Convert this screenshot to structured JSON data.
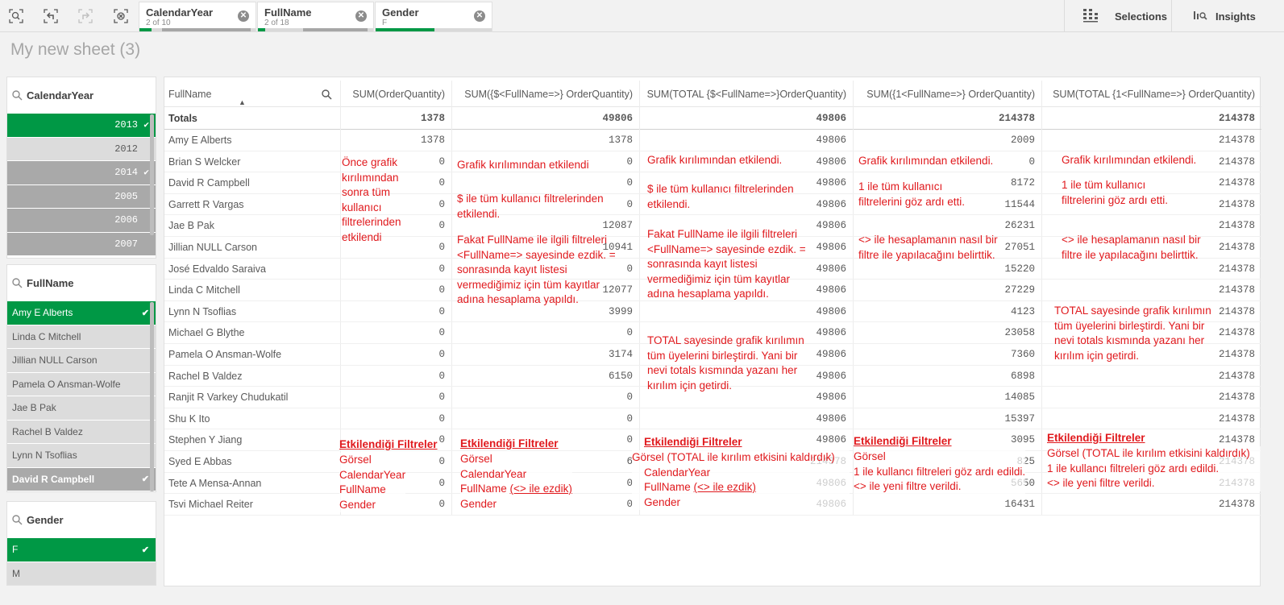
{
  "toolbar": {
    "chips": [
      {
        "title": "CalendarYear",
        "subtitle": "2 of 10",
        "selected_fraction": 0.2
      },
      {
        "title": "FullName",
        "subtitle": "2 of 18",
        "selected_fraction": 0.06
      },
      {
        "title": "Gender",
        "subtitle": "F",
        "selected_fraction": 0.5
      }
    ],
    "selections_label": "Selections",
    "insights_label": "Insights"
  },
  "sheet_title": "My new sheet (3)",
  "listboxes": {
    "calendar_year": {
      "title": "CalendarYear",
      "items": [
        {
          "label": "2013",
          "state": "selected"
        },
        {
          "label": "2012",
          "state": "alternative"
        },
        {
          "label": "2014",
          "state": "excluded-checked"
        },
        {
          "label": "2005",
          "state": "excluded"
        },
        {
          "label": "2006",
          "state": "excluded"
        },
        {
          "label": "2007",
          "state": "excluded"
        }
      ]
    },
    "full_name": {
      "title": "FullName",
      "items": [
        {
          "label": "Amy E Alberts",
          "state": "selected"
        },
        {
          "label": "Linda C Mitchell",
          "state": "alternative"
        },
        {
          "label": "Jillian NULL Carson",
          "state": "alternative"
        },
        {
          "label": "Pamela O Ansman-Wolfe",
          "state": "alternative"
        },
        {
          "label": "Jae B Pak",
          "state": "alternative"
        },
        {
          "label": "Rachel B Valdez",
          "state": "alternative"
        },
        {
          "label": "Lynn N Tsoflias",
          "state": "alternative"
        },
        {
          "label": "David R Campbell",
          "state": "excluded-checked"
        }
      ]
    },
    "gender": {
      "title": "Gender",
      "items": [
        {
          "label": "F",
          "state": "selected"
        },
        {
          "label": "M",
          "state": "alternative"
        }
      ]
    }
  },
  "table": {
    "columns": [
      "FullName",
      "SUM(OrderQuantity)",
      "SUM({$<FullName=>} OrderQuantity)",
      "SUM(TOTAL {$<FullName=>}OrderQuantity)",
      "SUM({1<FullName=>} OrderQuantity)",
      "SUM(TOTAL {1<FullName=>} OrderQuantity)"
    ],
    "totals": [
      "Totals",
      "1378",
      "49806",
      "49806",
      "214378",
      "214378"
    ],
    "rows": [
      [
        "Amy E Alberts",
        "1378",
        "1378",
        "49806",
        "2009",
        "214378"
      ],
      [
        "Brian S Welcker",
        "0",
        "0",
        "49806",
        "0",
        "214378"
      ],
      [
        "David R Campbell",
        "0",
        "0",
        "49806",
        "8172",
        "214378"
      ],
      [
        "Garrett R Vargas",
        "0",
        "0",
        "49806",
        "11544",
        "214378"
      ],
      [
        "Jae B Pak",
        "0",
        "12087",
        "49806",
        "26231",
        "214378"
      ],
      [
        "Jillian NULL Carson",
        "0",
        "10941",
        "49806",
        "27051",
        "214378"
      ],
      [
        "José Edvaldo Saraiva",
        "0",
        "0",
        "49806",
        "15220",
        "214378"
      ],
      [
        "Linda C Mitchell",
        "0",
        "12077",
        "49806",
        "27229",
        "214378"
      ],
      [
        "Lynn N Tsoflias",
        "0",
        "3999",
        "49806",
        "4123",
        "214378"
      ],
      [
        "Michael G Blythe",
        "0",
        "0",
        "49806",
        "23058",
        "214378"
      ],
      [
        "Pamela O Ansman-Wolfe",
        "0",
        "3174",
        "49806",
        "7360",
        "214378"
      ],
      [
        "Rachel B Valdez",
        "0",
        "6150",
        "49806",
        "6898",
        "214378"
      ],
      [
        "Ranjit R Varkey Chudukatil",
        "0",
        "0",
        "49806",
        "14085",
        "214378"
      ],
      [
        "Shu K Ito",
        "0",
        "0",
        "49806",
        "15397",
        "214378"
      ],
      [
        "Stephen Y Jiang",
        "0",
        "0",
        "49806",
        "3095",
        "214378"
      ],
      [
        "Syed E Abbas",
        "0",
        "6",
        "214378",
        "825",
        "214378"
      ],
      [
        "Tete A Mensa-Annan",
        "0",
        "0",
        "49806",
        "5650",
        "214378"
      ],
      [
        "Tsvi Michael Reiter",
        "0",
        "0",
        "49806",
        "16431",
        "214378"
      ]
    ]
  },
  "annotations": {
    "c1_main": "Önce  grafik kırılımından sonra tüm kullanıcı filtrelerinden etkilendi",
    "c2_a": "Grafik kırılımından etkilendi",
    "c2_b": "$ ile tüm kullanıcı filtrelerinden etkilendi.",
    "c2_c": "Fakat FullName ile ilgili filtreleri <FullName=> sayesinde ezdik. = sonrasında kayıt listesi vermediğimiz için tüm kayıtlar adına hesaplama yapıldı.",
    "c3_a": "Grafik kırılımından etkilendi.",
    "c3_b": "$ ile tüm kullanıcı filtrelerinden etkilendi.",
    "c3_c": "Fakat FullName ile ilgili filtreleri <FullName=> sayesinde ezdik. = sonrasında kayıt listesi vermediğimiz için tüm kayıtlar adına hesaplama yapıldı.",
    "c3_d": "TOTAL sayesinde grafik kırılımın tüm üyelerini birleştirdi. Yani bir nevi totals kısmında yazanı her kırılım için getirdi.",
    "c4_a": "Grafik kırılımından etkilendi.",
    "c4_b": "1 ile tüm kullanıcı filtrelerini göz ardı etti.",
    "c4_c": "<> ile hesaplamanın nasıl bir filtre ile yapılacağını belirttik.",
    "c5_a": "Grafik kırılımından etkilendi.",
    "c5_b": "1 ile tüm kullanıcı filtrelerini göz ardı etti.",
    "c5_c": "<> ile hesaplamanın nasıl bir filtre ile yapılacağını belirttik.",
    "c5_d": "TOTAL sayesinde grafik kırılımın tüm üyelerini birleştirdi. Yani bir nevi totals kısmında yazanı her kırılım için getirdi.",
    "heading": "Etkilendiği Filtreler",
    "f1": [
      "Görsel",
      "CalendarYear",
      "FullName",
      "Gender"
    ],
    "f2": [
      "Görsel",
      "CalendarYear",
      "FullName",
      "(<> ile ezdik)",
      "Gender"
    ],
    "f3": [
      "Görsel (TOTAL ile kırılım etkisini kaldırdık)",
      "CalendarYear",
      "FullName",
      "(<> ile ezdik)",
      "Gender"
    ],
    "f4": [
      "Görsel",
      "1 ile kullancı filtreleri göz ardı edildi.",
      "<> ile yeni filtre verildi."
    ],
    "f5": [
      "Görsel (TOTAL ile kırılım etkisini kaldırdık)",
      "1 ile kullancı filtreleri göz ardı edildi.",
      "<> ile yeni filtre verildi."
    ]
  },
  "colors": {
    "selected": "#009845",
    "alternative": "#dcdcdc",
    "excluded": "#a9a9a9",
    "annotation": "#e0191d"
  }
}
